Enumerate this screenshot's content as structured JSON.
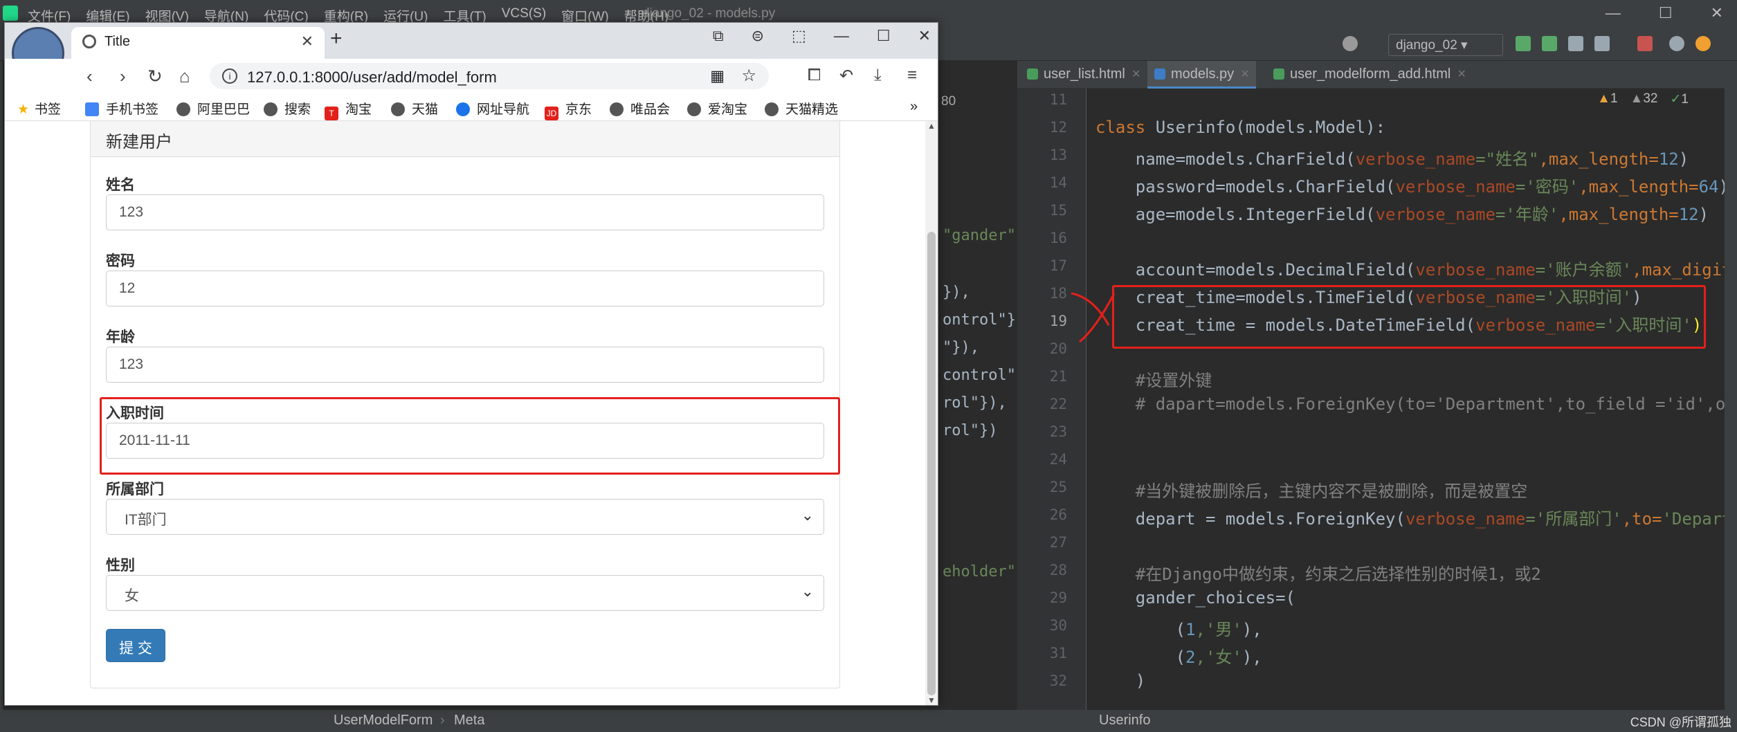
{
  "ide": {
    "menu": [
      "文件(F)",
      "编辑(E)",
      "视图(V)",
      "导航(N)",
      "代码(C)",
      "重构(R)",
      "运行(U)",
      "工具(T)",
      "VCS(S)",
      "窗口(W)",
      "帮助(H)"
    ],
    "file_title": "django_02 - models.py",
    "run_config": "django_02",
    "tabs": [
      "user_list.html",
      "models.py",
      "user_modelform_add.html"
    ],
    "inspections": {
      "warn1": "1",
      "warn2": "32",
      "ok": "1"
    },
    "mid_badge": "80",
    "mid_code": [
      "\"gander\"",
      "}),",
      "ontrol\"})",
      "\"}),",
      "control\"",
      "rol\"}),",
      "rol\"})",
      "eholder\""
    ],
    "line_numbers": [
      "11",
      "12",
      "13",
      "14",
      "15",
      "16",
      "17",
      "18",
      "19",
      "20",
      "21",
      "22",
      "23",
      "24",
      "25",
      "26",
      "27",
      "28",
      "29",
      "30",
      "31",
      "32"
    ],
    "code": {
      "l12": {
        "kw": "class ",
        "name": "Userinfo(models.Model):"
      },
      "l13": {
        "a": "    name=models.CharField(",
        "p": "verbose_name",
        "s": "=\"姓名\"",
        "b": ",max_length=",
        "n": "12",
        "c": ")"
      },
      "l14": {
        "a": "    password=models.CharField(",
        "p": "verbose_name",
        "s": "='密码'",
        "b": ",max_length=",
        "n": "64",
        "c": ")"
      },
      "l15": {
        "a": "    age=models.IntegerField(",
        "p": "verbose_name",
        "s": "='年龄'",
        "b": ",max_length=",
        "n": "12",
        "c": ")"
      },
      "l17": {
        "a": "    account=models.DecimalField(",
        "p": "verbose_name",
        "s": "='账户余额'",
        "b": ",max_digits"
      },
      "l18": {
        "a": "    creat_time=models.TimeField(",
        "p": "verbose_name",
        "s": "='入职时间'",
        "c": ")"
      },
      "l19": {
        "a": "    creat_time = models.DateTimeField(",
        "p": "verbose_name",
        "s": "='入职时间'",
        "c": ")"
      },
      "l21": "    #设置外键",
      "l22": "    # dapart=models.ForeignKey(to='Department',to_field ='id',on_",
      "l25": "    #当外键被删除后，主键内容不是被删除，而是被置空",
      "l26": {
        "a": "    depart = models.ForeignKey(",
        "p": "verbose_name",
        "s": "='所属部门'",
        "b": ",to=",
        "s2": "'Departm"
      },
      "l28": "    #在Django中做约束，约束之后选择性别的时候1，或2",
      "l29": "    gander_choices=(",
      "l30": {
        "a": "        (",
        "n": "1",
        "s": ",'男'",
        "c": "),"
      },
      "l31": {
        "a": "        (",
        "n": "2",
        "s": ",'女'",
        "c": "),"
      },
      "l32": "    )"
    },
    "status": {
      "left1": "UserModelForm",
      "left2": "Meta",
      "right": "Userinfo"
    },
    "watermark": "CSDN @所谓孤独"
  },
  "browser": {
    "tab_title": "Title",
    "url": "127.0.0.1:8000/user/add/model_form",
    "bookmarks": [
      "书签",
      "手机书签",
      "阿里巴巴",
      "搜索",
      "淘宝",
      "天猫",
      "网址导航",
      "京东",
      "唯品会",
      "爱淘宝",
      "天猫精选"
    ],
    "more": "»"
  },
  "form": {
    "heading": "新建用户",
    "fields": [
      {
        "label": "姓名",
        "value": "123"
      },
      {
        "label": "密码",
        "value": "12"
      },
      {
        "label": "年龄",
        "value": "123"
      },
      {
        "label": "入职时间",
        "value": "2011-11-11"
      }
    ],
    "selects": [
      {
        "label": "所属部门",
        "value": "IT部门"
      },
      {
        "label": "性别",
        "value": "女"
      }
    ],
    "submit": "提 交"
  }
}
